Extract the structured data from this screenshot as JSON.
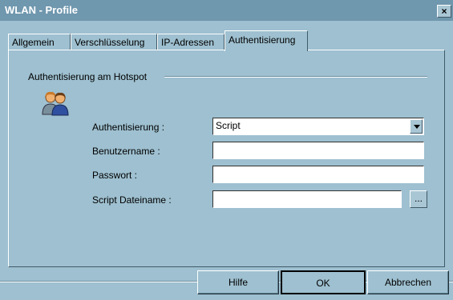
{
  "window": {
    "title": "WLAN - Profile",
    "close_label": "×"
  },
  "tabs": [
    {
      "label": "Allgemein",
      "active": false
    },
    {
      "label": "Verschlüsselung",
      "active": false
    },
    {
      "label": "IP-Adressen",
      "active": false
    },
    {
      "label": "Authentisierung",
      "active": true
    }
  ],
  "group": {
    "title": "Authentisierung am Hotspot",
    "icon": "users-icon"
  },
  "fields": {
    "auth": {
      "label": "Authentisierung :",
      "value": "Script"
    },
    "username": {
      "label": "Benutzername :",
      "value": ""
    },
    "password": {
      "label": "Passwort :",
      "value": ""
    },
    "script": {
      "label": "Script Dateiname :",
      "value": "",
      "browse_label": "..."
    }
  },
  "buttons": {
    "help": "Hilfe",
    "ok": "OK",
    "cancel": "Abbrechen"
  }
}
